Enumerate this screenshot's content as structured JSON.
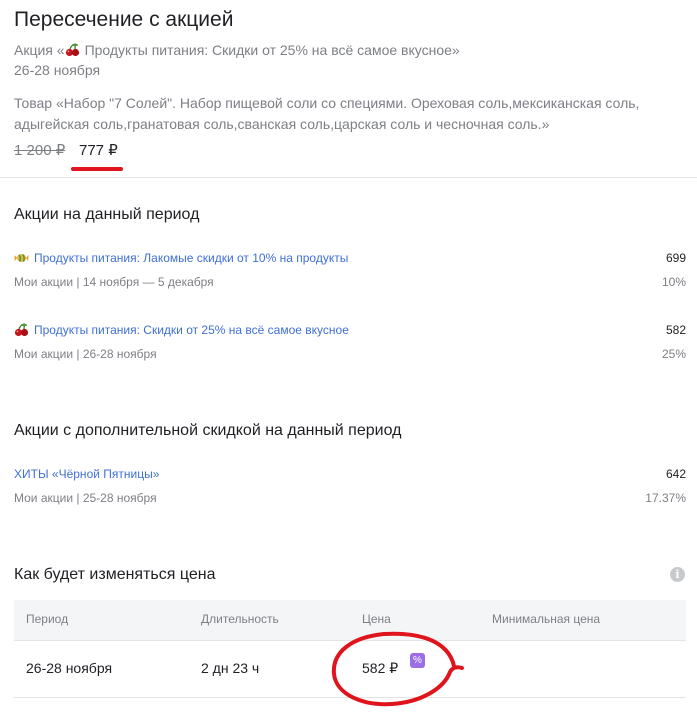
{
  "header": {
    "title": "Пересечение с акцией",
    "promo_prefix": "Акция «",
    "promo_icon": "cherries-icon",
    "promo_name": "Продукты питания: Скидки от 25% на всё самое вкусное»",
    "promo_dates": "26-28 ноября",
    "product_description": "Товар «Набор \"7 Солей\". Набор пищевой соли со специями. Ореховая соль,мексиканская соль, адыгейская соль,гранатовая соль,сванская соль,царская соль и чесночная соль.»",
    "old_price": "1 200 ₽",
    "new_price": "777 ₽"
  },
  "period_promos": {
    "title": "Акции на данный период",
    "items": [
      {
        "icon": "candy-icon",
        "name": "Продукты питания: Лакомые скидки от 10% на продукты",
        "value": "699",
        "meta": "Мои акции | 14 ноября — 5 декабря",
        "percent": "10%"
      },
      {
        "icon": "cherries-icon",
        "name": "Продукты питания: Скидки от 25% на всё самое вкусное",
        "value": "582",
        "meta": "Мои акции | 26-28 ноября",
        "percent": "25%"
      }
    ]
  },
  "extra_promos": {
    "title": "Акции с дополнительной скидкой на данный период",
    "items": [
      {
        "name": "ХИТЫ «Чёрной Пятницы»",
        "value": "642",
        "meta": "Мои акции | 25-28 ноября",
        "percent": "17.37%"
      }
    ]
  },
  "price_changes": {
    "title": "Как будет изменяться цена",
    "info_icon": "info-icon",
    "columns": [
      "Период",
      "Длительность",
      "Цена",
      "Минимальная цена"
    ],
    "rows": [
      {
        "period": "26-28 ноября",
        "duration": "2 дн 23 ч",
        "price": "582 ₽",
        "badge": "%",
        "min_price": ""
      }
    ]
  },
  "colors": {
    "link": "#3f6fd6",
    "muted": "#7d7f85",
    "annotation_red": "#e0141c",
    "badge_purple": "#9b6ee6"
  }
}
